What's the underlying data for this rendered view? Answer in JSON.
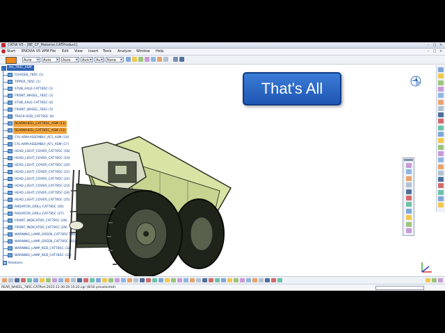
{
  "window": {
    "title": "CATIA V5 - [BE_CF_Material.CATProduct]",
    "controls": {
      "minimize": "–",
      "maximize": "□",
      "close": "×"
    }
  },
  "menu": {
    "items": [
      "Start",
      "ENOVIA V5 VPM",
      "File",
      "Edit",
      "View",
      "Insert",
      "Tools",
      "Analyze",
      "Window",
      "Help"
    ],
    "controls": {
      "minimize": "–",
      "maximize": "□",
      "close": "×"
    }
  },
  "toolbar": {
    "color_swatch": "#f08a1c",
    "combos": [
      "Auto",
      "Auto",
      "Auto",
      "Auto",
      "Auto",
      "None"
    ],
    "combo_arrow": "▾"
  },
  "tree": {
    "root": "AH_785C_ASM",
    "nodes": [
      {
        "label": "CHASSIS_785C (1)",
        "highlight": false
      },
      {
        "label": "TIPPER_785C (1)",
        "highlight": false
      },
      {
        "label": "STUB_AXLE-CAT785C (1)",
        "highlight": false
      },
      {
        "label": "FRONT_WHEEL_785C (1)",
        "highlight": false
      },
      {
        "label": "STUB_AXLE-CAT785C (4)",
        "highlight": false
      },
      {
        "label": "FRONT_WHEEL_785C (5)",
        "highlight": false
      },
      {
        "label": "TRACK ROD_CAT785C (6)",
        "highlight": false
      },
      {
        "label": "REARWHEEL_CAT785C_ASM (11)",
        "highlight": true
      },
      {
        "label": "REARWHEEL_CAT785C_ASM (11)",
        "highlight": true
      },
      {
        "label": "CYL-ARM-ASSEMBLY_AF1_ASM (14)",
        "highlight": false
      },
      {
        "label": "CYL-ARM-ASSEMBLY_AF1_ASM (17)",
        "highlight": false
      },
      {
        "label": "HEAD_LIGHT_COVER_CAT785C (18)",
        "highlight": false
      },
      {
        "label": "HEAD_LIGHT_COVER_CAT785C (19)",
        "highlight": false
      },
      {
        "label": "HEAD_LIGHT_COVER_CAT785C (20)",
        "highlight": false
      },
      {
        "label": "HEAD_LIGHT_COVER_CAT785C (21)",
        "highlight": false
      },
      {
        "label": "HEAD_LIGHT_COVER_CAT785C (22)",
        "highlight": false
      },
      {
        "label": "HEAD_LIGHT_COVER_CAT785C (23)",
        "highlight": false
      },
      {
        "label": "HEAD_LIGHT_COVER_CAT785C (24)",
        "highlight": false
      },
      {
        "label": "HEAD_LIGHT_COVER_CAT785C (25)",
        "highlight": false
      },
      {
        "label": "RADIATOR_GRILL-CAT785C (26)",
        "highlight": false
      },
      {
        "label": "RADIATOR_GRILL-CAT785C (27)",
        "highlight": false
      },
      {
        "label": "FRONT_INDICATOR_CAT785C (28)",
        "highlight": false
      },
      {
        "label": "FRONT_INDICATOR_CAT785C (29)",
        "highlight": false
      },
      {
        "label": "WARNING_LAMP_GREEN_CAT785C (30)",
        "highlight": false
      },
      {
        "label": "WARNING_LAMP_GREEN_CAT785C (31)",
        "highlight": false
      },
      {
        "label": "WARNING_LAMP_RED_CAT785C (32)",
        "highlight": false
      },
      {
        "label": "WARNING_LAMP_RED_CAT785C (33)",
        "highlight": false
      }
    ],
    "relations_label": "Relations"
  },
  "callout": {
    "text": "That's All"
  },
  "status": {
    "message": "REAR_WHEEL_785C.CATPart.2015-11-30-20.15.22.cgr (8/10 preselected)"
  },
  "colors": {
    "accent": "#2f63b3",
    "highlight": "#f1a43a",
    "callout": "#2a6acb",
    "truck_body": "#d8e3a4",
    "tire": "#1e2419"
  },
  "icons": [
    "compass-icon",
    "axis-icon",
    "app-icon",
    "catia-logo-icon"
  ]
}
